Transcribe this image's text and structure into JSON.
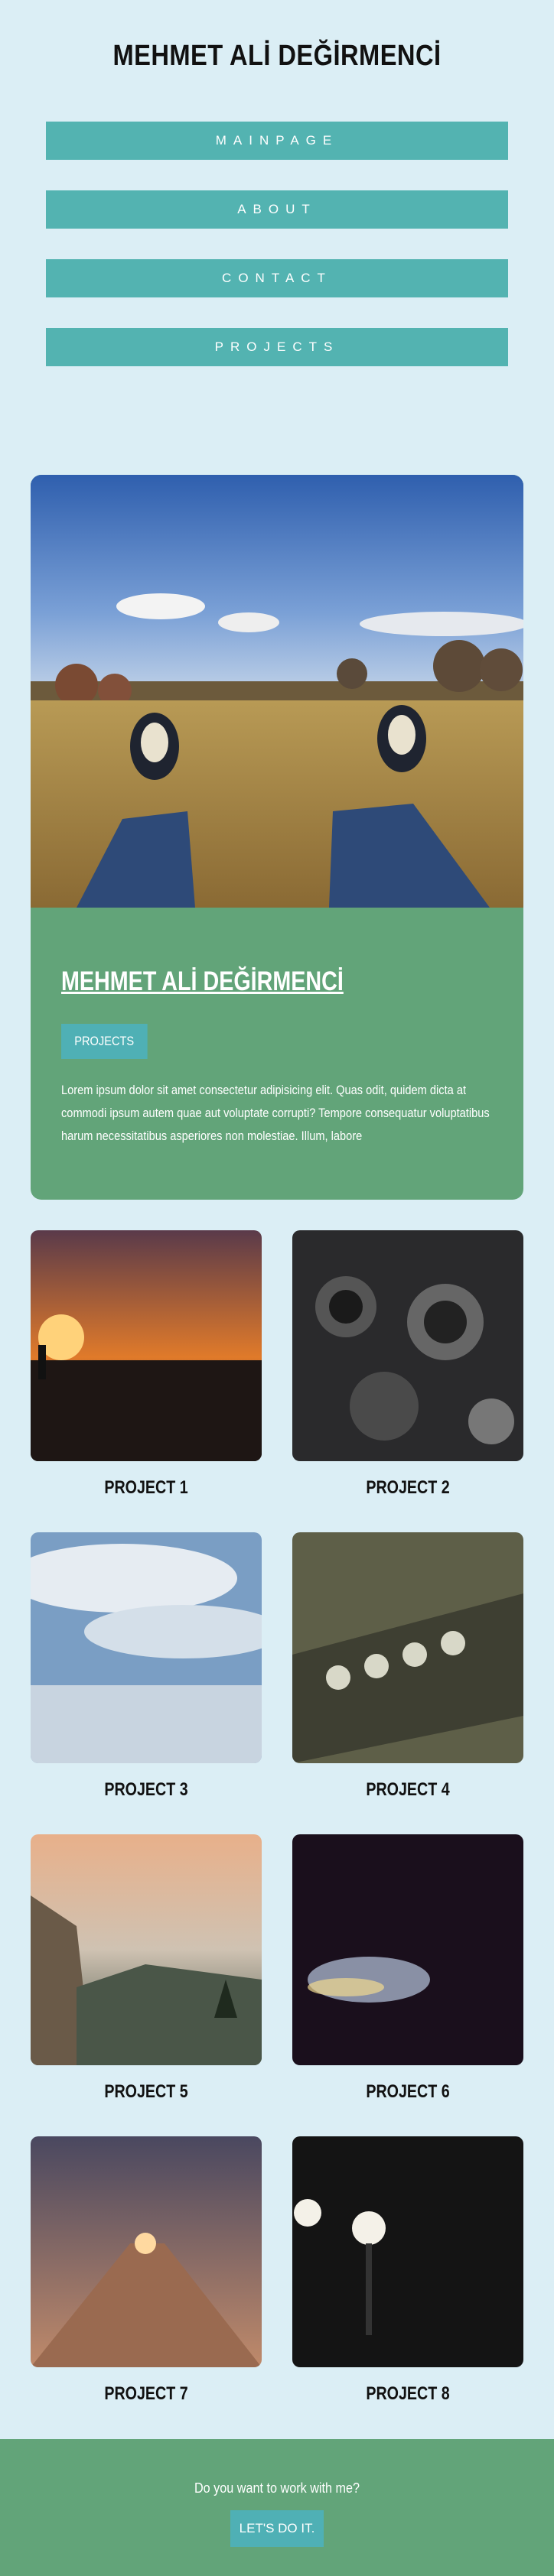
{
  "header": {
    "title": "MEHMET ALİ DEĞİRMENCİ"
  },
  "nav": {
    "items": [
      {
        "label": "MAINPAGE"
      },
      {
        "label": "ABOUT"
      },
      {
        "label": "CONTACT"
      },
      {
        "label": "PROJECTS"
      }
    ]
  },
  "hero": {
    "title": "MEHMET ALİ DEĞİRMENCİ",
    "button_label": "PROJECTS",
    "text": "Lorem ipsum dolor sit amet consectetur adipisicing elit. Quas odit, quidem dicta at commodi ipsum autem quae aut voluptate corrupti? Tempore consequatur voluptatibus harum necessitatibus asperiores non molestiae. Illum, labore"
  },
  "projects": [
    {
      "label": "PROJECT 1"
    },
    {
      "label": "PROJECT 2"
    },
    {
      "label": "PROJECT 3"
    },
    {
      "label": "PROJECT 4"
    },
    {
      "label": "PROJECT 5"
    },
    {
      "label": "PROJECT 6"
    },
    {
      "label": "PROJECT 7"
    },
    {
      "label": "PROJECT 8"
    }
  ],
  "footer": {
    "text": "Do you want to work with me?",
    "button_label": "LET'S DO IT."
  },
  "colors": {
    "background": "#dbeef5",
    "nav_button": "#53b3b1",
    "green_panel": "#62a479",
    "accent_button": "#4fb0b5"
  }
}
